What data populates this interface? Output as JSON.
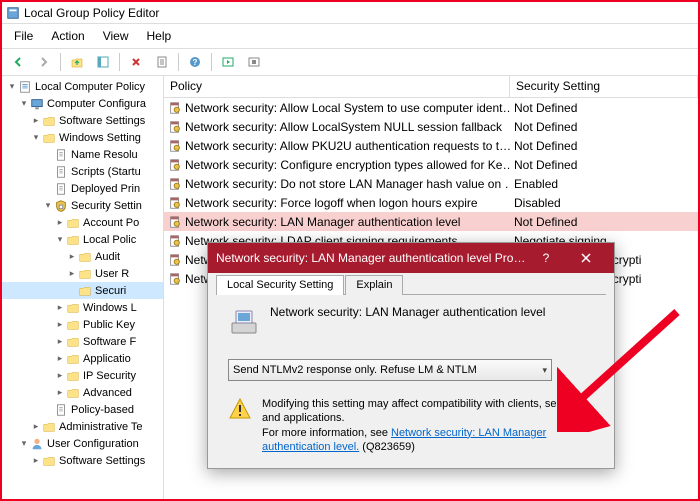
{
  "window": {
    "title": "Local Group Policy Editor"
  },
  "menu": [
    "File",
    "Action",
    "View",
    "Help"
  ],
  "tree": [
    {
      "d": 0,
      "e": "-",
      "i": "root",
      "t": "Local Computer Policy"
    },
    {
      "d": 1,
      "e": "-",
      "i": "comp",
      "t": "Computer Configura"
    },
    {
      "d": 2,
      "e": ">",
      "i": "fold",
      "t": "Software Settings"
    },
    {
      "d": 2,
      "e": "-",
      "i": "fold",
      "t": "Windows Setting"
    },
    {
      "d": 3,
      "e": " ",
      "i": "doc",
      "t": "Name Resolu"
    },
    {
      "d": 3,
      "e": " ",
      "i": "doc",
      "t": "Scripts (Startu"
    },
    {
      "d": 3,
      "e": " ",
      "i": "doc",
      "t": "Deployed Prin"
    },
    {
      "d": 3,
      "e": "-",
      "i": "sec",
      "t": "Security Settin"
    },
    {
      "d": 4,
      "e": ">",
      "i": "fold",
      "t": "Account Po"
    },
    {
      "d": 4,
      "e": "-",
      "i": "fold",
      "t": "Local Polic"
    },
    {
      "d": 5,
      "e": ">",
      "i": "fold",
      "t": "Audit"
    },
    {
      "d": 5,
      "e": ">",
      "i": "fold",
      "t": "User R"
    },
    {
      "d": 5,
      "e": " ",
      "i": "fold",
      "t": "Securi",
      "sel": true
    },
    {
      "d": 4,
      "e": ">",
      "i": "fold",
      "t": "Windows L"
    },
    {
      "d": 4,
      "e": ">",
      "i": "fold",
      "t": "Public Key"
    },
    {
      "d": 4,
      "e": ">",
      "i": "fold",
      "t": "Software F"
    },
    {
      "d": 4,
      "e": ">",
      "i": "fold",
      "t": "Applicatio"
    },
    {
      "d": 4,
      "e": ">",
      "i": "fold",
      "t": "IP Security"
    },
    {
      "d": 4,
      "e": ">",
      "i": "fold",
      "t": "Advanced"
    },
    {
      "d": 3,
      "e": " ",
      "i": "doc",
      "t": "Policy-based"
    },
    {
      "d": 2,
      "e": ">",
      "i": "fold",
      "t": "Administrative Te"
    },
    {
      "d": 1,
      "e": "-",
      "i": "user",
      "t": "User Configuration"
    },
    {
      "d": 2,
      "e": ">",
      "i": "fold",
      "t": "Software Settings"
    }
  ],
  "columns": {
    "policy": "Policy",
    "setting": "Security Setting"
  },
  "policies": [
    {
      "name": "Network security: Allow Local System to use computer ident…",
      "val": "Not Defined"
    },
    {
      "name": "Network security: Allow LocalSystem NULL session fallback",
      "val": "Not Defined"
    },
    {
      "name": "Network security: Allow PKU2U authentication requests to t…",
      "val": "Not Defined"
    },
    {
      "name": "Network security: Configure encryption types allowed for Ke…",
      "val": "Not Defined"
    },
    {
      "name": "Network security: Do not store LAN Manager hash value on …",
      "val": "Enabled"
    },
    {
      "name": "Network security: Force logoff when logon hours expire",
      "val": "Disabled"
    },
    {
      "name": "Network security: LAN Manager authentication level",
      "val": "Not Defined",
      "sel": true
    },
    {
      "name": "Network security: LDAP client signing requirements",
      "val": "Negotiate signing"
    },
    {
      "name": "Network security: Minimum session security for NTLM SSP …",
      "val": "Require 128-bit encrypti"
    },
    {
      "name": "Network security: Minimum session security for NTLM SSP …",
      "val": "Require 128-bit encrypti"
    }
  ],
  "dialog": {
    "title": "Network security: LAN Manager authentication level Prop…",
    "tabs": [
      "Local Security Setting",
      "Explain"
    ],
    "policy_name": "Network security: LAN Manager authentication level",
    "selected_option": "Send NTLMv2 response only. Refuse LM & NTLM",
    "warning_pre": "Modifying this setting may affect compatibility with clients, services, and applications.",
    "warning_moreinfo": "For more information, see ",
    "warning_link": "Network security: LAN Manager authentication level.",
    "warning_kb": " (Q823659)"
  }
}
